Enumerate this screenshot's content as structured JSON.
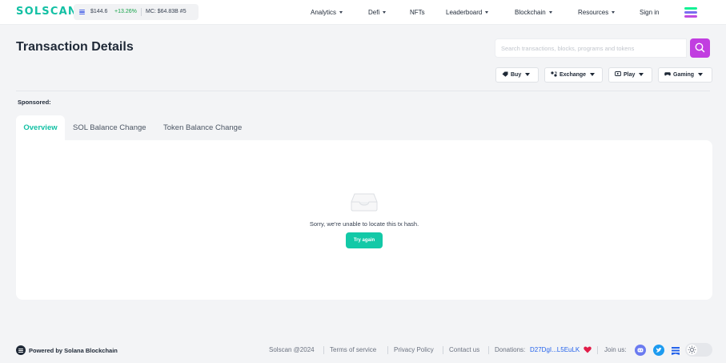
{
  "header": {
    "logo_text": "SOLSCAN",
    "sol_price": "$144.6",
    "sol_change": "+13.26%",
    "market_cap": "MC: $64.83B  #5",
    "nav": [
      {
        "label": "Analytics",
        "has_dropdown": true
      },
      {
        "label": "Defi",
        "has_dropdown": true
      },
      {
        "label": "NFTs",
        "has_dropdown": false
      },
      {
        "label": "Leaderboard",
        "has_dropdown": true
      },
      {
        "label": "Blockchain",
        "has_dropdown": true
      },
      {
        "label": "Resources",
        "has_dropdown": true
      },
      {
        "label": "Sign in",
        "has_dropdown": false
      }
    ],
    "menu_icon": "solana-menu-icon"
  },
  "page": {
    "title": "Transaction Details",
    "search_placeholder": "Search transactions, blocks, programs and tokens",
    "search_icon": "search-icon"
  },
  "sponsor_buttons": [
    {
      "label": "Buy",
      "icon": "tag-icon"
    },
    {
      "label": "Exchange",
      "icon": "exchange-icon"
    },
    {
      "label": "Play",
      "icon": "play-icon"
    },
    {
      "label": "Gaming",
      "icon": "gamepad-icon"
    }
  ],
  "sponsored_label": "Sponsored:",
  "tabs": [
    {
      "label": "Overview",
      "active": true
    },
    {
      "label": "SOL Balance Change",
      "active": false
    },
    {
      "label": "Token Balance Change",
      "active": false
    }
  ],
  "empty_state": {
    "icon": "empty-inbox-icon",
    "message": "Sorry, we're unable to locate this tx hash.",
    "button": "Try again"
  },
  "footer": {
    "powered_by": "Powered by Solana Blockchain",
    "copyright": "Solscan @2024",
    "terms": "Terms of service",
    "privacy": "Privacy Policy",
    "contact": "Contact us",
    "donations_label": "Donations:",
    "donation_address": "D27DgI...L5EuLK",
    "join_label": "Join us:",
    "social_icons": [
      "discord-icon",
      "twitter-icon",
      "medium-icon"
    ],
    "theme_toggle_icon": "sun-icon"
  },
  "colors": {
    "brand_teal": "#13c0a4",
    "search_button": "#c13ee0",
    "positive_change": "#16a34a",
    "link_blue": "#2563eb",
    "heart_red": "#e11d48"
  }
}
